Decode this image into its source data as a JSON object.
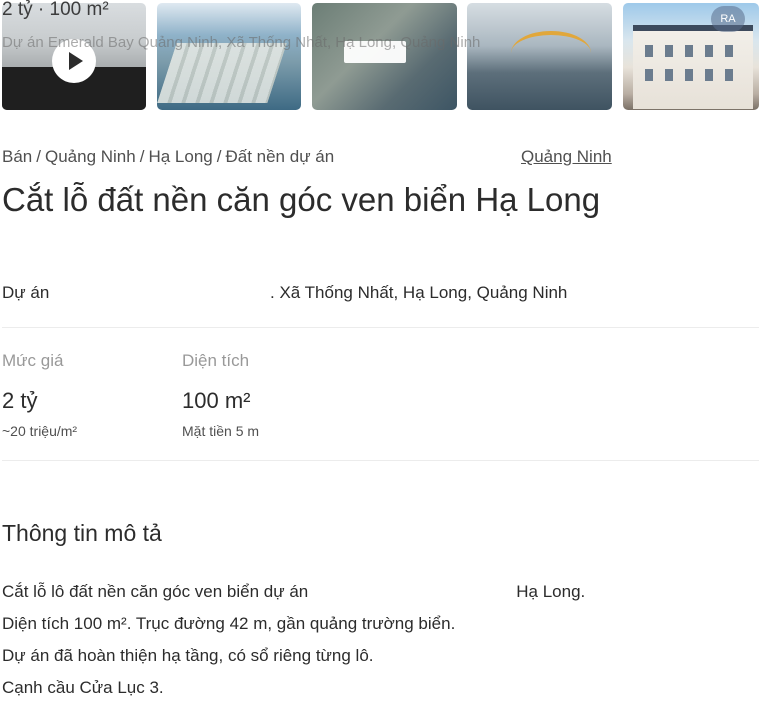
{
  "gallery": {
    "overlay_price_area": "2 tỷ · 100 m²",
    "overlay_address": "Dự án Emerald Bay Quảng Ninh, Xã Thống Nhất, Hạ Long, Quảng Ninh",
    "video_label": "play",
    "badge": "RA",
    "thumbnails": [
      "video-thumbnail",
      "masterplan-thumbnail",
      "map-thumbnail",
      "bridge-thumbnail",
      "building-thumbnail"
    ]
  },
  "breadcrumb": {
    "items": [
      "Bán",
      "Quảng Ninh",
      "Hạ Long",
      "Đất nền dự án"
    ],
    "separator": "/",
    "tail": "Quảng Ninh"
  },
  "listing": {
    "title": "Cắt lỗ đất nền căn góc ven biển Hạ Long",
    "project_label": "Dự án",
    "project_address": ". Xã Thống Nhất, Hạ Long, Quảng Ninh"
  },
  "stats": {
    "price": {
      "label": "Mức giá",
      "value": "2 tỷ",
      "sub": "~20 triệu/m²"
    },
    "area": {
      "label": "Diện tích",
      "value": "100 m²",
      "sub": "Mặt tiền 5 m"
    }
  },
  "description": {
    "heading": "Thông tin mô tả",
    "line1_start": "Cắt lỗ lô đất nền căn góc ven biển dự án",
    "line1_end": "Hạ Long.",
    "line2": "Diện tích 100 m². Trục đường 42 m, gần quảng trường biển.",
    "line3": "Dự án đã hoàn thiện hạ tầng, có sổ riêng từng lô.",
    "line4": "Cạnh cầu Cửa Lục 3."
  }
}
